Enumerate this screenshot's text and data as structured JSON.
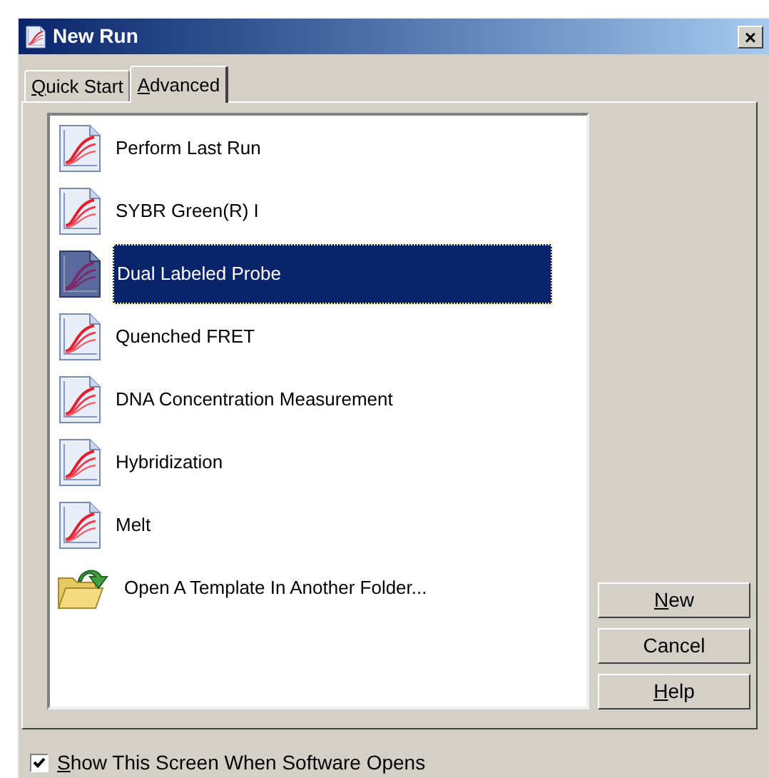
{
  "window": {
    "title": "New Run",
    "close": "×"
  },
  "tabs": [
    {
      "label": "Quick Start",
      "selected": false,
      "mnemonic": true
    },
    {
      "label": "Advanced",
      "selected": true,
      "mnemonic": true
    }
  ],
  "items": [
    {
      "label": "Perform Last Run",
      "kind": "chart",
      "selected": false
    },
    {
      "label": "SYBR Green(R) I",
      "kind": "chart",
      "selected": false
    },
    {
      "label": "Dual Labeled Probe",
      "kind": "chart",
      "selected": true
    },
    {
      "label": "Quenched FRET",
      "kind": "chart",
      "selected": false
    },
    {
      "label": "DNA Concentration Measurement",
      "kind": "chart",
      "selected": false
    },
    {
      "label": "Hybridization",
      "kind": "chart",
      "selected": false
    },
    {
      "label": "Melt",
      "kind": "chart",
      "selected": false
    },
    {
      "label": "Open A Template In Another Folder...",
      "kind": "folder",
      "selected": false
    }
  ],
  "buttons": [
    {
      "label": "New",
      "mnemonic": true
    },
    {
      "label": "Cancel",
      "mnemonic": false
    },
    {
      "label": "Help",
      "mnemonic": true
    }
  ],
  "show_on_open": {
    "label": "Show This Screen When Software Opens",
    "checked": true,
    "mnemonic": true
  }
}
